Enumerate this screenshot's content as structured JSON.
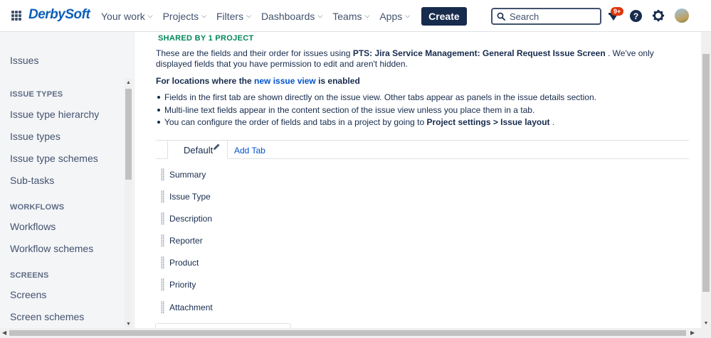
{
  "header": {
    "logo_text": "DerbySoft",
    "nav": [
      {
        "label": "Your work"
      },
      {
        "label": "Projects"
      },
      {
        "label": "Filters"
      },
      {
        "label": "Dashboards"
      },
      {
        "label": "Teams"
      },
      {
        "label": "Apps"
      }
    ],
    "create_label": "Create",
    "search_placeholder": "Search",
    "notifications_badge": "9+",
    "help_glyph": "?"
  },
  "sidebar": {
    "top_link": "Issues",
    "sections": [
      {
        "heading": "ISSUE TYPES",
        "items": [
          "Issue type hierarchy",
          "Issue types",
          "Issue type schemes",
          "Sub-tasks"
        ]
      },
      {
        "heading": "WORKFLOWS",
        "items": [
          "Workflows",
          "Workflow schemes"
        ]
      },
      {
        "heading": "SCREENS",
        "items": [
          "Screens",
          "Screen schemes"
        ]
      }
    ]
  },
  "main": {
    "shared_label": "SHARED BY 1 PROJECT",
    "intro_pre": "These are the fields and their order for issues using ",
    "intro_screen": "PTS: Jira Service Management: General Request Issue Screen",
    "intro_post": " . We've only displayed fields that you have permission to edit and aren't hidden.",
    "loc_pre": "For locations where the ",
    "loc_link": "new issue view",
    "loc_post": " is enabled",
    "bullets": {
      "b1": "Fields in the first tab are shown directly on the issue view. Other tabs appear as panels in the issue details section.",
      "b2": "Multi-line text fields appear in the content section of the issue view unless you place them in a tab.",
      "b3_pre": "You can configure the order of fields and tabs in a project by going to ",
      "b3_bold": "Project settings > Issue layout",
      "b3_post": " ."
    },
    "tabs": {
      "default_label": "Default",
      "add_tab_label": "Add Tab"
    },
    "fields": [
      "Summary",
      "Issue Type",
      "Description",
      "Reporter",
      "Product",
      "Priority",
      "Attachment"
    ]
  },
  "colors": {
    "brand": "#0c5fb8",
    "link": "#0052cc",
    "shared_green": "#00875a",
    "badge_red": "#de350b",
    "create_bg": "#172b4d"
  },
  "icons": [
    "app-switcher-icon",
    "search-icon",
    "bell-icon",
    "help-icon",
    "gear-icon",
    "pencil-icon",
    "drag-handle-icon",
    "chevron-down-icon"
  ]
}
